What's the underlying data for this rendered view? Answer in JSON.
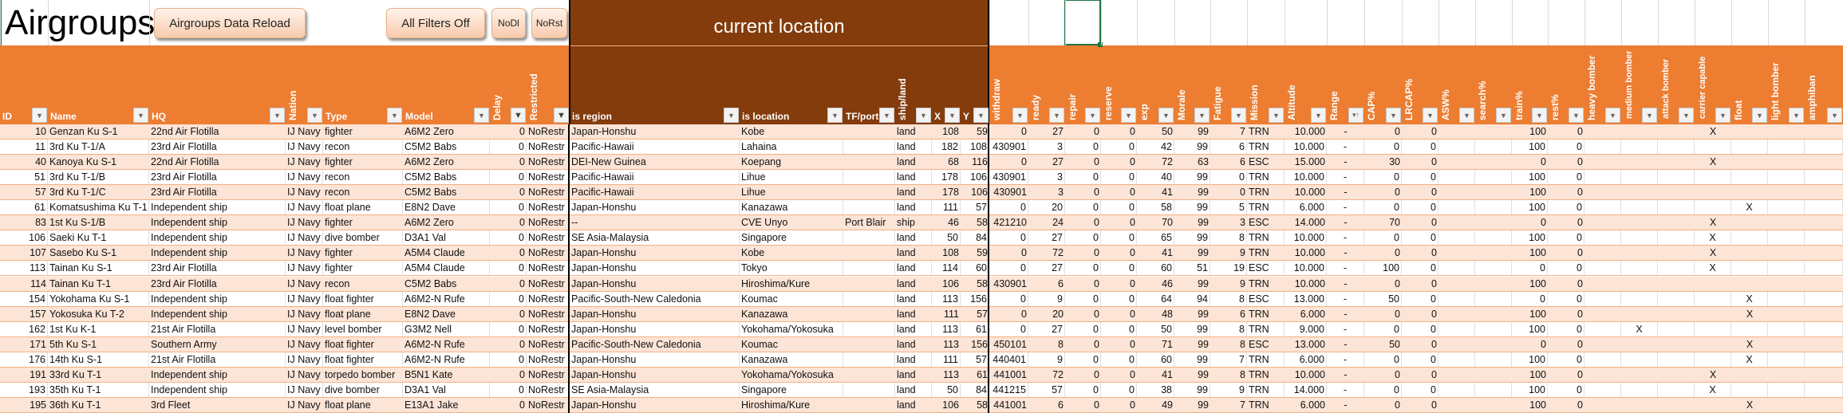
{
  "sheet": {
    "title": "Airgroups",
    "buttons": {
      "reload": "Airgroups Data Reload",
      "filters_off": "All Filters Off",
      "nodl": "NoDl",
      "norst": "NoRst"
    },
    "location_group_title": "current location"
  },
  "colors": {
    "header_orange": "#ED7D31",
    "header_brown": "#843C0C",
    "stripe": "#FCE4D6",
    "selection": "#217346"
  },
  "table": {
    "columns": [
      {
        "label": "ID",
        "filter": "dropdown"
      },
      {
        "label": "Name",
        "filter": "dropdown"
      },
      {
        "label": "HQ",
        "filter": "dropdown"
      },
      {
        "label": "Nation",
        "filter": "dropdown"
      },
      {
        "label": "Type",
        "filter": "dropdown"
      },
      {
        "label": "Model",
        "filter": "dropdown"
      },
      {
        "label": "Delay",
        "filter": "funnel"
      },
      {
        "label": "Restricted",
        "filter": "funnel"
      },
      {
        "label": "is region",
        "filter": "dropdown"
      },
      {
        "label": "is location",
        "filter": "dropdown"
      },
      {
        "label": "TF/port",
        "filter": "dropdown"
      },
      {
        "label": "ship/land",
        "filter": "dropdown"
      },
      {
        "label": "X",
        "filter": "dropdown"
      },
      {
        "label": "Y",
        "filter": "dropdown"
      },
      {
        "label": "withdraw",
        "filter": "dropdown"
      },
      {
        "label": "ready",
        "filter": "dropdown"
      },
      {
        "label": "repair",
        "filter": "dropdown"
      },
      {
        "label": "reserve",
        "filter": "dropdown"
      },
      {
        "label": "exp",
        "filter": "dropdown"
      },
      {
        "label": "Morale",
        "filter": "dropdown"
      },
      {
        "label": "Fatigue",
        "filter": "dropdown"
      },
      {
        "label": "Mission",
        "filter": "dropdown"
      },
      {
        "label": "Altitude",
        "filter": "dropdown"
      },
      {
        "label": "Range",
        "filter": "sort-ascending"
      },
      {
        "label": "CAP%",
        "filter": "dropdown"
      },
      {
        "label": "LRCAP%",
        "filter": "dropdown"
      },
      {
        "label": "ASW%",
        "filter": "dropdown"
      },
      {
        "label": "search%",
        "filter": "dropdown"
      },
      {
        "label": "train%",
        "filter": "dropdown"
      },
      {
        "label": "rest%",
        "filter": "dropdown"
      },
      {
        "label": "heavy bomber",
        "filter": "dropdown"
      },
      {
        "label": "medium bomber",
        "filter": "dropdown"
      },
      {
        "label": "attack bomber",
        "filter": "dropdown"
      },
      {
        "label": "carrier capable",
        "filter": "dropdown"
      },
      {
        "label": "float",
        "filter": "dropdown"
      },
      {
        "label": "light bomber",
        "filter": "dropdown"
      },
      {
        "label": "amphiban",
        "filter": "dropdown"
      }
    ],
    "rows": [
      [
        "10",
        "Genzan Ku S-1",
        "22nd Air Flotilla",
        "IJ Navy",
        "fighter",
        "A6M2 Zero",
        "0",
        "NoRestr",
        "Japan-Honshu",
        "Kobe",
        "",
        "land",
        "108",
        "59",
        "0",
        "27",
        "0",
        "0",
        "50",
        "99",
        "7",
        "TRN",
        "10.000",
        "-",
        "0",
        "0",
        "",
        "",
        "100",
        "0",
        "",
        "",
        "",
        "X",
        "",
        "",
        ""
      ],
      [
        "11",
        "3rd Ku T-1/A",
        "23rd Air Flotilla",
        "IJ Navy",
        "recon",
        "C5M2 Babs",
        "0",
        "NoRestr",
        "Pacific-Hawaii",
        "Lahaina",
        "",
        "land",
        "182",
        "108",
        "430901",
        "3",
        "0",
        "0",
        "42",
        "99",
        "6",
        "TRN",
        "10.000",
        "-",
        "0",
        "0",
        "",
        "",
        "100",
        "0",
        "",
        "",
        "",
        "",
        "",
        "",
        ""
      ],
      [
        "40",
        "Kanoya Ku S-1",
        "22nd Air Flotilla",
        "IJ Navy",
        "fighter",
        "A6M2 Zero",
        "0",
        "NoRestr",
        "DEI-New Guinea",
        "Koepang",
        "",
        "land",
        "68",
        "116",
        "0",
        "27",
        "0",
        "0",
        "72",
        "63",
        "6",
        "ESC",
        "15.000",
        "-",
        "30",
        "0",
        "",
        "",
        "0",
        "0",
        "",
        "",
        "",
        "X",
        "",
        "",
        ""
      ],
      [
        "51",
        "3rd Ku T-1/B",
        "23rd Air Flotilla",
        "IJ Navy",
        "recon",
        "C5M2 Babs",
        "0",
        "NoRestr",
        "Pacific-Hawaii",
        "Lihue",
        "",
        "land",
        "178",
        "106",
        "430901",
        "3",
        "0",
        "0",
        "40",
        "99",
        "0",
        "TRN",
        "10.000",
        "-",
        "0",
        "0",
        "",
        "",
        "100",
        "0",
        "",
        "",
        "",
        "",
        "",
        "",
        ""
      ],
      [
        "57",
        "3rd Ku T-1/C",
        "23rd Air Flotilla",
        "IJ Navy",
        "recon",
        "C5M2 Babs",
        "0",
        "NoRestr",
        "Pacific-Hawaii",
        "Lihue",
        "",
        "land",
        "178",
        "106",
        "430901",
        "3",
        "0",
        "0",
        "41",
        "99",
        "0",
        "TRN",
        "10.000",
        "-",
        "0",
        "0",
        "",
        "",
        "100",
        "0",
        "",
        "",
        "",
        "",
        "",
        "",
        ""
      ],
      [
        "61",
        "Komatsushima Ku T-1",
        "Independent ship",
        "IJ Navy",
        "float plane",
        "E8N2 Dave",
        "0",
        "NoRestr",
        "Japan-Honshu",
        "Kanazawa",
        "",
        "land",
        "111",
        "57",
        "0",
        "20",
        "0",
        "0",
        "58",
        "99",
        "5",
        "TRN",
        "6.000",
        "-",
        "0",
        "0",
        "",
        "",
        "100",
        "0",
        "",
        "",
        "",
        "",
        "X",
        "",
        ""
      ],
      [
        "83",
        "1st Ku S-1/B",
        "Independent ship",
        "IJ Navy",
        "fighter",
        "A6M2 Zero",
        "0",
        "NoRestr",
        "--",
        "CVE Unyo",
        "Port Blair",
        "ship",
        "46",
        "58",
        "421210",
        "24",
        "0",
        "0",
        "70",
        "99",
        "3",
        "ESC",
        "14.000",
        "-",
        "70",
        "0",
        "",
        "",
        "0",
        "0",
        "",
        "",
        "",
        "X",
        "",
        "",
        ""
      ],
      [
        "106",
        "Saeki Ku T-1",
        "Independent ship",
        "IJ Navy",
        "dive bomber",
        "D3A1 Val",
        "0",
        "NoRestr",
        "SE Asia-Malaysia",
        "Singapore",
        "",
        "land",
        "50",
        "84",
        "0",
        "27",
        "0",
        "0",
        "65",
        "99",
        "8",
        "TRN",
        "10.000",
        "-",
        "0",
        "0",
        "",
        "",
        "100",
        "0",
        "",
        "",
        "",
        "X",
        "",
        "",
        ""
      ],
      [
        "107",
        "Sasebo Ku S-1",
        "Independent ship",
        "IJ Navy",
        "fighter",
        "A5M4 Claude",
        "0",
        "NoRestr",
        "Japan-Honshu",
        "Kobe",
        "",
        "land",
        "108",
        "59",
        "0",
        "72",
        "0",
        "0",
        "41",
        "99",
        "9",
        "TRN",
        "10.000",
        "-",
        "0",
        "0",
        "",
        "",
        "100",
        "0",
        "",
        "",
        "",
        "X",
        "",
        "",
        ""
      ],
      [
        "113",
        "Tainan Ku S-1",
        "23rd Air Flotilla",
        "IJ Navy",
        "fighter",
        "A5M4 Claude",
        "0",
        "NoRestr",
        "Japan-Honshu",
        "Tokyo",
        "",
        "land",
        "114",
        "60",
        "0",
        "27",
        "0",
        "0",
        "60",
        "51",
        "19",
        "ESC",
        "10.000",
        "-",
        "100",
        "0",
        "",
        "",
        "0",
        "0",
        "",
        "",
        "",
        "X",
        "",
        "",
        ""
      ],
      [
        "114",
        "Tainan Ku T-1",
        "23rd Air Flotilla",
        "IJ Navy",
        "recon",
        "C5M2 Babs",
        "0",
        "NoRestr",
        "Japan-Honshu",
        "Hiroshima/Kure",
        "",
        "land",
        "106",
        "58",
        "430901",
        "6",
        "0",
        "0",
        "46",
        "99",
        "9",
        "TRN",
        "10.000",
        "-",
        "0",
        "0",
        "",
        "",
        "100",
        "0",
        "",
        "",
        "",
        "",
        "",
        "",
        ""
      ],
      [
        "154",
        "Yokohama Ku S-1",
        "Independent ship",
        "IJ Navy",
        "float fighter",
        "A6M2-N Rufe",
        "0",
        "NoRestr",
        "Pacific-South-New Caledonia",
        "Koumac",
        "",
        "land",
        "113",
        "156",
        "0",
        "9",
        "0",
        "0",
        "64",
        "94",
        "8",
        "ESC",
        "13.000",
        "-",
        "50",
        "0",
        "",
        "",
        "0",
        "0",
        "",
        "",
        "",
        "",
        "X",
        "",
        ""
      ],
      [
        "157",
        "Yokosuka Ku T-2",
        "Independent ship",
        "IJ Navy",
        "float plane",
        "E8N2 Dave",
        "0",
        "NoRestr",
        "Japan-Honshu",
        "Kanazawa",
        "",
        "land",
        "111",
        "57",
        "0",
        "20",
        "0",
        "0",
        "48",
        "99",
        "6",
        "TRN",
        "6.000",
        "-",
        "0",
        "0",
        "",
        "",
        "100",
        "0",
        "",
        "",
        "",
        "",
        "X",
        "",
        ""
      ],
      [
        "162",
        "1st Ku K-1",
        "21st Air Flotilla",
        "IJ Navy",
        "level bomber",
        "G3M2 Nell",
        "0",
        "NoRestr",
        "Japan-Honshu",
        "Yokohama/Yokosuka",
        "",
        "land",
        "113",
        "61",
        "0",
        "27",
        "0",
        "0",
        "50",
        "99",
        "8",
        "TRN",
        "9.000",
        "-",
        "0",
        "0",
        "",
        "",
        "100",
        "0",
        "",
        "X",
        "",
        "",
        "",
        "",
        ""
      ],
      [
        "171",
        "5th Ku S-1",
        "Southern Army",
        "IJ Navy",
        "float fighter",
        "A6M2-N Rufe",
        "0",
        "NoRestr",
        "Pacific-South-New Caledonia",
        "Koumac",
        "",
        "land",
        "113",
        "156",
        "450101",
        "8",
        "0",
        "0",
        "71",
        "99",
        "8",
        "ESC",
        "13.000",
        "-",
        "50",
        "0",
        "",
        "",
        "0",
        "0",
        "",
        "",
        "",
        "",
        "X",
        "",
        ""
      ],
      [
        "176",
        "14th Ku S-1",
        "21st Air Flotilla",
        "IJ Navy",
        "float fighter",
        "A6M2-N Rufe",
        "0",
        "NoRestr",
        "Japan-Honshu",
        "Kanazawa",
        "",
        "land",
        "111",
        "57",
        "440401",
        "9",
        "0",
        "0",
        "60",
        "99",
        "7",
        "TRN",
        "6.000",
        "-",
        "0",
        "0",
        "",
        "",
        "100",
        "0",
        "",
        "",
        "",
        "",
        "X",
        "",
        ""
      ],
      [
        "191",
        "33rd Ku T-1",
        "Independent ship",
        "IJ Navy",
        "torpedo bomber",
        "B5N1 Kate",
        "0",
        "NoRestr",
        "Japan-Honshu",
        "Yokohama/Yokosuka",
        "",
        "land",
        "113",
        "61",
        "441001",
        "72",
        "0",
        "0",
        "41",
        "99",
        "8",
        "TRN",
        "10.000",
        "-",
        "0",
        "0",
        "",
        "",
        "100",
        "0",
        "",
        "",
        "",
        "X",
        "",
        "",
        ""
      ],
      [
        "193",
        "35th Ku T-1",
        "Independent ship",
        "IJ Navy",
        "dive bomber",
        "D3A1 Val",
        "0",
        "NoRestr",
        "SE Asia-Malaysia",
        "Singapore",
        "",
        "land",
        "50",
        "84",
        "441215",
        "57",
        "0",
        "0",
        "38",
        "99",
        "9",
        "TRN",
        "14.000",
        "-",
        "0",
        "0",
        "",
        "",
        "100",
        "0",
        "",
        "",
        "",
        "X",
        "",
        "",
        ""
      ],
      [
        "195",
        "36th Ku T-1",
        "3rd Fleet",
        "IJ Navy",
        "float plane",
        "E13A1 Jake",
        "0",
        "NoRestr",
        "Japan-Honshu",
        "Hiroshima/Kure",
        "",
        "land",
        "106",
        "58",
        "441001",
        "6",
        "0",
        "0",
        "49",
        "99",
        "7",
        "TRN",
        "6.000",
        "-",
        "0",
        "0",
        "",
        "",
        "100",
        "0",
        "",
        "",
        "",
        "",
        "X",
        "",
        ""
      ]
    ]
  }
}
